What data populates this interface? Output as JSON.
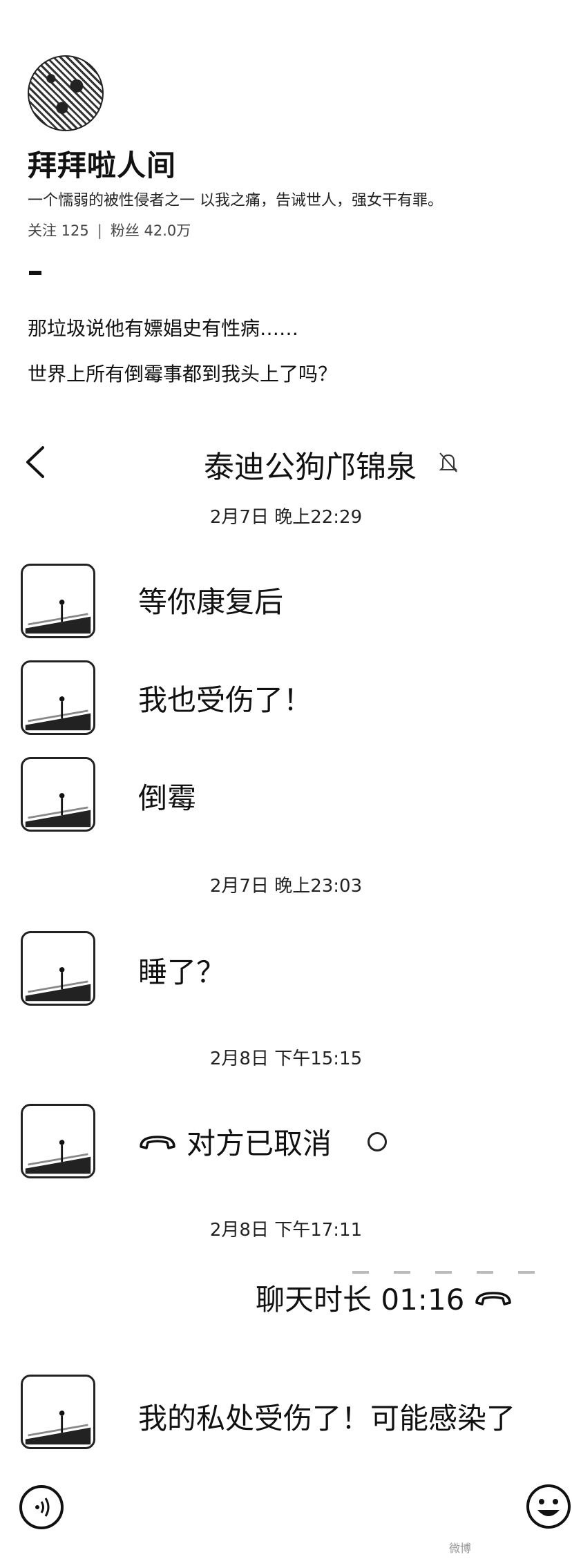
{
  "profile": {
    "name": "拜拜啦人间",
    "bio": "一个懦弱的被性侵者之一  以我之痛，告诫世人，强女干有罪。",
    "following_label": "关注 125",
    "stats_separator": "|",
    "followers_label": "粉丝 42.0万"
  },
  "post": {
    "line1": "那垃圾说他有嫖娼史有性病……",
    "line2": "世界上所有倒霉事都到我头上了吗？"
  },
  "chat": {
    "title": "泰迪公狗邝锦泉",
    "icons": {
      "back": "chevron-left-icon",
      "mute": "bell-off-icon",
      "call": "phone-icon",
      "voice": "voice-icon",
      "emoji": "smiley-icon"
    },
    "timestamps": {
      "t1": "2月7日 晚上22:29",
      "t2": "2月7日 晚上23:03",
      "t3": "2月8日 下午15:15",
      "t4": "2月8日 下午17:11"
    },
    "messages": {
      "m1": "等你康复后",
      "m2": "我也受伤了！",
      "m3": "倒霉",
      "m4": "睡了？",
      "m5": "对方已取消",
      "m6": "聊天时长 01:16",
      "m7": "我的私处受伤了！可能感染了"
    }
  },
  "watermark": "微博"
}
